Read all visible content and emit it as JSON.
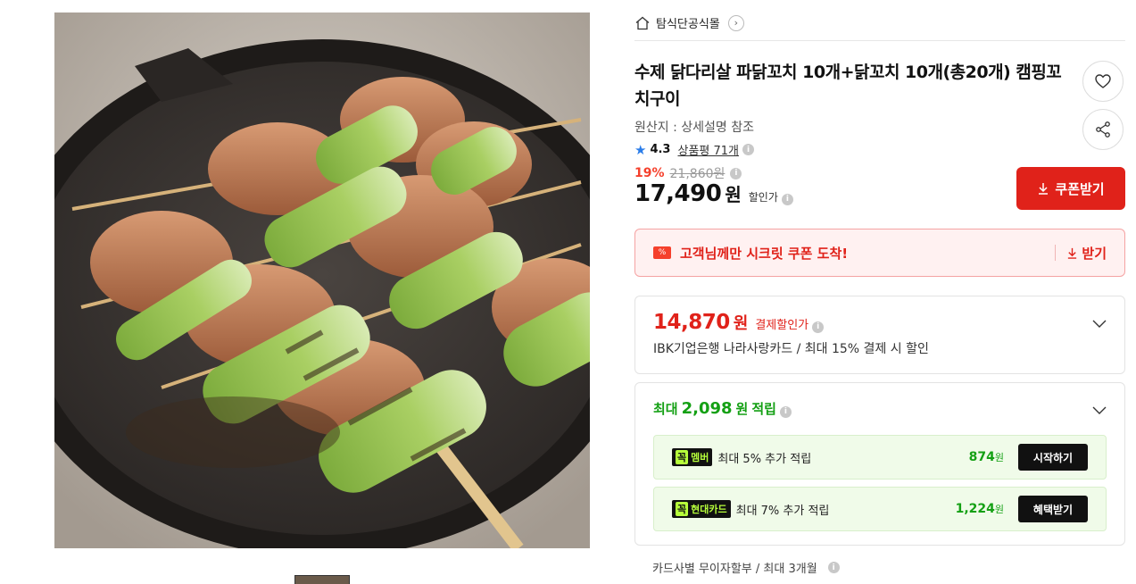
{
  "store": {
    "name": "탐식단공식몰",
    "home_icon": "home-icon",
    "chevron": "›"
  },
  "product": {
    "title": "수제 닭다리살 파닭꼬치 10개+닭꼬치 10개(총20개) 캠핑꼬치구이",
    "origin": "원산지 : 상세설명 참조",
    "rating": "4.3",
    "review_label": "상품평 71개",
    "discount_rate": "19%",
    "original_price": "21,860원",
    "price": "17,490",
    "price_unit": "원",
    "price_note": "할인가"
  },
  "coupon_button": {
    "label": "쿠폰받기",
    "icon": "download-icon"
  },
  "secret_coupon": {
    "badge": "%",
    "text": "고객님께만 시크릿 쿠폰 도착!",
    "action": "받기"
  },
  "card_discount": {
    "price": "14,870",
    "unit": "원",
    "label": "결제할인가",
    "desc": "IBK기업은행 나라사랑카드 / 최대 15% 결제 시 할인"
  },
  "points": {
    "prefix": "최대",
    "amount": "2,098",
    "unit": "원",
    "suffix": "적립",
    "rows": [
      {
        "badge_kkok": "꼭",
        "badge": "멤버",
        "desc": "최대 5% 추가 적립",
        "pts": "874",
        "pts_unit": "원",
        "action": "시작하기"
      },
      {
        "badge_kkok": "꼭",
        "badge": "현대카드",
        "desc": "최대 7% 추가 적립",
        "pts": "1,224",
        "pts_unit": "원",
        "action": "혜택받기"
      }
    ]
  },
  "installment": {
    "text": "카드사별 무이자할부 / 최대 3개월"
  },
  "colors": {
    "accent_red": "#e0221a",
    "points_green": "#14a014",
    "star_blue": "#2b7de9"
  }
}
